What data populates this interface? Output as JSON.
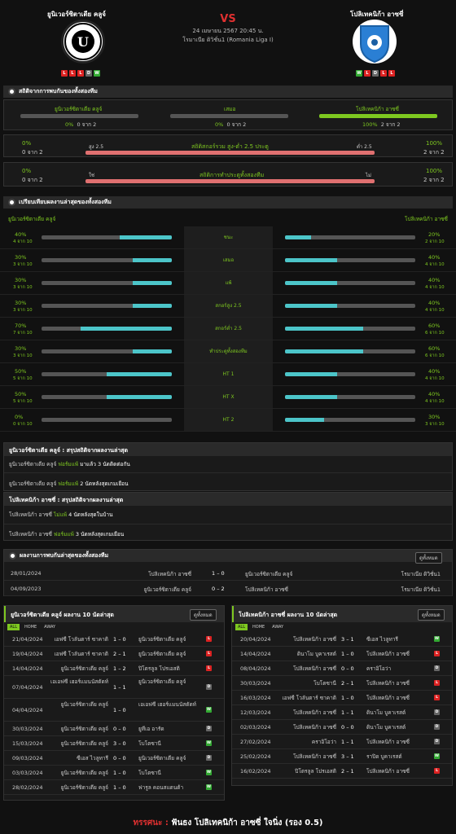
{
  "home": {
    "name": "ยูนิเวอร์ซิตาเตีย คลูจ์",
    "form": [
      "L",
      "L",
      "L",
      "D",
      "W"
    ]
  },
  "away": {
    "name": "โปลิเทคนิก้า อาซซี่",
    "form": [
      "W",
      "L",
      "D",
      "L",
      "L"
    ]
  },
  "match": {
    "vs": "VS",
    "datetime": "24 เมษายน 2567 20:45 น.",
    "league": "โรมาเนีย ดิวิชั่น1 (Romania Liga I)"
  },
  "h2h": {
    "title": "สถิติจากการพบกันของทั้งสองทีม",
    "home_label": "ยูนิเวอร์ซิตาเตีย คลูจ์",
    "draw_label": "เสมอ",
    "away_label": "โปลิเทคนิก้า อาซซี่",
    "home_pct": "0%",
    "home_count": "0 จาก 2",
    "draw_pct": "0%",
    "draw_count": "0 จาก 2",
    "away_pct": "100%",
    "away_count": "2 จาก 2",
    "ou": {
      "l_pct": "0%",
      "l_count": "0 จาก 2",
      "over": "สูง 2.5",
      "label": "สถิติสกอร์รวม สูง-ต่ำ 2.5 ประตู",
      "under": "ต่ำ 2.5",
      "r_pct": "100%",
      "r_count": "2 จาก 2"
    },
    "bt": {
      "l_pct": "0%",
      "l_count": "0 จาก 2",
      "yes": "ใช่",
      "label": "สถิติการทำประตูทั้งสองทีม",
      "no": "ไม่",
      "r_pct": "100%",
      "r_count": "2 จาก 2"
    }
  },
  "compare": {
    "title": "เปรียบเทียบผลงานล่าสุดของทั้งสองทีม",
    "home": "ยูนิเวอร์ซิตาเตีย คลูจ์",
    "away": "โปลิเทคนิก้า อาซซี่",
    "rows": [
      {
        "label": "ชนะ",
        "lp": "40%",
        "lc": "4 จาก 10",
        "lv": 0.4,
        "rp": "20%",
        "rc": "2 จาก 10",
        "rv": 0.2
      },
      {
        "label": "เสมอ",
        "lp": "30%",
        "lc": "3 จาก 10",
        "lv": 0.3,
        "rp": "40%",
        "rc": "4 จาก 10",
        "rv": 0.4
      },
      {
        "label": "แพ้",
        "lp": "30%",
        "lc": "3 จาก 10",
        "lv": 0.3,
        "rp": "40%",
        "rc": "4 จาก 10",
        "rv": 0.4
      },
      {
        "label": "สกอร์สูง 2.5",
        "lp": "30%",
        "lc": "3 จาก 10",
        "lv": 0.3,
        "rp": "40%",
        "rc": "4 จาก 10",
        "rv": 0.4
      },
      {
        "label": "สกอร์ต่ำ 2.5",
        "lp": "70%",
        "lc": "7 จาก 10",
        "lv": 0.7,
        "rp": "60%",
        "rc": "6 จาก 10",
        "rv": 0.6
      },
      {
        "label": "ทำประตูทั้งสองทีม",
        "lp": "30%",
        "lc": "3 จาก 10",
        "lv": 0.3,
        "rp": "60%",
        "rc": "6 จาก 10",
        "rv": 0.6
      },
      {
        "label": "HT 1",
        "lp": "50%",
        "lc": "5 จาก 10",
        "lv": 0.5,
        "rp": "40%",
        "rc": "4 จาก 10",
        "rv": 0.4
      },
      {
        "label": "HT X",
        "lp": "50%",
        "lc": "5 จาก 10",
        "lv": 0.5,
        "rp": "40%",
        "rc": "4 จาก 10",
        "rv": 0.4
      },
      {
        "label": "HT 2",
        "lp": "0%",
        "lc": "0 จาก 10",
        "lv": 0,
        "rp": "30%",
        "rc": "3 จาก 10",
        "rv": 0.3
      }
    ]
  },
  "sum_home": {
    "title": "ยูนิเวอร์ซิตาเตีย คลูจ์ : สรุปสถิติจากผลงานล่าสุด",
    "l1a": "ยูนิเวอร์ซิตาเตีย คลูจ์",
    "l1b": "ฟอร์มแพ้",
    "l1c": "มาแล้ว 3 นัดติดต่อกัน",
    "l2a": "ยูนิเวอร์ซิตาเตีย คลูจ์",
    "l2b": "ฟอร์มแพ้",
    "l2c": "2 นัดหลังสุดเกมเยือน"
  },
  "sum_away": {
    "title": "โปลิเทคนิก้า อาซซี่ : สรุปสถิติจากผลงานล่าสุด",
    "l1a": "โปลิเทคนิก้า อาซซี่",
    "l1b": "ไม่แพ้",
    "l1c": "4 นัดหลังสุดในบ้าน",
    "l2a": "โปลิเทคนิก้า อาซซี่",
    "l2b": "ฟอร์มแพ้",
    "l2c": "3 นัดหลังสุดเกมเยือน"
  },
  "h2hres": {
    "title": "ผลงานการพบกันล่าสุดของทั้งสองทีม",
    "btn": "ดูทั้งหมด",
    "rows": [
      {
        "d": "28/01/2024",
        "h": "โปลิเทคนิก้า อาซซี่",
        "s": "1 – 0",
        "a": "ยูนิเวอร์ซิตาเตีย คลูจ์",
        "l": "โรมาเนีย ดิวิชั่น1"
      },
      {
        "d": "04/09/2023",
        "h": "ยูนิเวอร์ซิตาเตีย คลูจ์",
        "s": "0 – 2",
        "a": "โปลิเทคนิก้า อาซซี่",
        "l": "โรมาเนีย ดิวิชั่น1"
      }
    ]
  },
  "last_home": {
    "title": "ยูนิเวอร์ซิตาเตีย คลูจ์ ผลงาน 10 นัดล่าสุด",
    "btn": "ดูทั้งหมด",
    "tabs": [
      "ALL",
      "HOME",
      "AWAY"
    ],
    "rows": [
      {
        "d": "21/04/2024",
        "h": "เอฟซี โวลันตาร์ ซาคาติ",
        "s": "1 – 0",
        "a": "ยูนิเวอร์ซิตาเตีย คลูจ์",
        "r": "L"
      },
      {
        "d": "19/04/2024",
        "h": "เอฟซี โวลันตาร์ ซาคาติ",
        "s": "2 – 1",
        "a": "ยูนิเวอร์ซิตาเตีย คลูจ์",
        "r": "L"
      },
      {
        "d": "14/04/2024",
        "h": "ยูนิเวอร์ซิตาเตีย คลูจ์",
        "s": "1 – 2",
        "a": "ปิโตรลูล โปรเอสติ",
        "r": "L"
      },
      {
        "d": "07/04/2024",
        "h": "เอเอฟซี เฮอร์แมนนัสตัดท์",
        "s": "1 – 1",
        "a": "ยูนิเวอร์ซิตาเตีย คลูจ์",
        "r": "D"
      },
      {
        "d": "04/04/2024",
        "h": "ยูนิเวอร์ซิตาเตีย คลูจ์",
        "s": "1 – 0",
        "a": "เอเอฟซี เฮอร์แมนนัสตัดท์",
        "r": "W"
      },
      {
        "d": "30/03/2024",
        "h": "ยูนิเวอร์ซิตาเตีย คลูจ์",
        "s": "0 – 0",
        "a": "ยูทีเอ อารัด",
        "r": "D"
      },
      {
        "d": "15/03/2024",
        "h": "ยูนิเวอร์ซิตาเตีย คลูจ์",
        "s": "3 – 0",
        "a": "โบโตซานี",
        "r": "W"
      },
      {
        "d": "09/03/2024",
        "h": "ซีเอส ไวลูทารี",
        "s": "0 – 0",
        "a": "ยูนิเวอร์ซิตาเตีย คลูจ์",
        "r": "D"
      },
      {
        "d": "03/03/2024",
        "h": "ยูนิเวอร์ซิตาเตีย คลูจ์",
        "s": "1 – 0",
        "a": "โบโตซานี",
        "r": "W"
      },
      {
        "d": "28/02/2024",
        "h": "ยูนิเวอร์ซิตาเตีย คลูจ์",
        "s": "1 – 0",
        "a": "ฟารูล คอนสแตนต้า",
        "r": "W"
      }
    ]
  },
  "last_away": {
    "title": "โปลิเทคนิก้า อาซซี่ ผลงาน 10 นัดล่าสุด",
    "btn": "ดูทั้งหมด",
    "tabs": [
      "ALL",
      "HOME",
      "AWAY"
    ],
    "rows": [
      {
        "d": "20/04/2024",
        "h": "โปลิเทคนิก้า อาซซี่",
        "s": "3 – 1",
        "a": "ซีเอส ไวลูทารี",
        "r": "W"
      },
      {
        "d": "14/04/2024",
        "h": "ดินาโม บูคาเรสต์",
        "s": "1 – 0",
        "a": "โปลิเทคนิก้า อาซซี่",
        "r": "L"
      },
      {
        "d": "08/04/2024",
        "h": "โปลิเทคนิก้า อาซซี่",
        "s": "0 – 0",
        "a": "คราอิโอว่า",
        "r": "D"
      },
      {
        "d": "30/03/2024",
        "h": "โบโตซานี",
        "s": "2 – 1",
        "a": "โปลิเทคนิก้า อาซซี่",
        "r": "L"
      },
      {
        "d": "16/03/2024",
        "h": "เอฟซี โวลันตาร์ ซาคาติ",
        "s": "1 – 0",
        "a": "โปลิเทคนิก้า อาซซี่",
        "r": "L"
      },
      {
        "d": "12/03/2024",
        "h": "โปลิเทคนิก้า อาซซี่",
        "s": "1 – 1",
        "a": "ดินาโม บูคาเรสต์",
        "r": "D"
      },
      {
        "d": "02/03/2024",
        "h": "โปลิเทคนิก้า อาซซี่",
        "s": "0 – 0",
        "a": "ดินาโม บูคาเรสต์",
        "r": "D"
      },
      {
        "d": "27/02/2024",
        "h": "คราอิโอว่า",
        "s": "1 – 1",
        "a": "โปลิเทคนิก้า อาซซี่",
        "r": "D"
      },
      {
        "d": "25/02/2024",
        "h": "โปลิเทคนิก้า อาซซี่",
        "s": "3 – 1",
        "a": "ราปิด บูคาเรสต์",
        "r": "W"
      },
      {
        "d": "16/02/2024",
        "h": "ปิโตรลูล โปรเอสติ",
        "s": "2 – 1",
        "a": "โปลิเทคนิก้า อาซซี่",
        "r": "L"
      }
    ]
  },
  "tip": {
    "label": "ทรรศนะ :",
    "text": "ฟันธง โปลิเทคนิก้า อาซซี่ ใจนิ่ง (รอง 0.5)"
  },
  "colors": {
    "green": "#7ec820",
    "red": "#e03030",
    "teal": "#4cc5c9",
    "win": "#3a3",
    "loss": "#d22",
    "draw": "#666"
  }
}
